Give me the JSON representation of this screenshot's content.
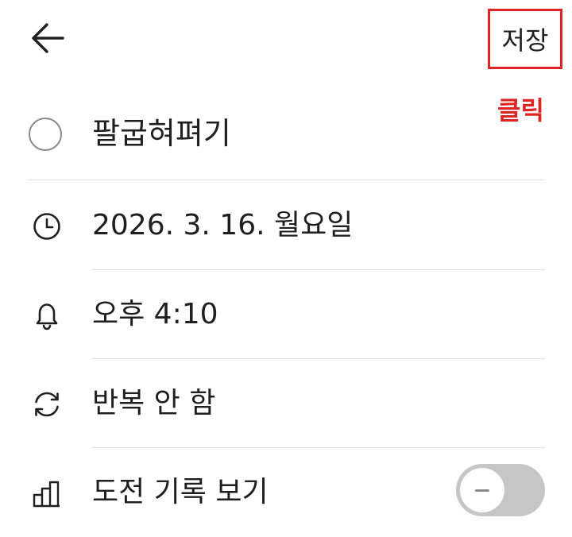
{
  "header": {
    "back_icon": "arrow-left-icon",
    "save_label": "저장",
    "annotation": "클릭",
    "annotation_color": "#e02424"
  },
  "task": {
    "title": "팔굽혀펴기",
    "completed": false
  },
  "rows": {
    "date": {
      "icon": "clock-icon",
      "label": "2026. 3. 16. 월요일"
    },
    "alarm": {
      "icon": "bell-icon",
      "label": "오후 4:10"
    },
    "repeat": {
      "icon": "repeat-icon",
      "label": "반복 안 함"
    },
    "challenge": {
      "icon": "bar-chart-icon",
      "label": "도전 기록 보기",
      "toggle_on": false
    }
  }
}
